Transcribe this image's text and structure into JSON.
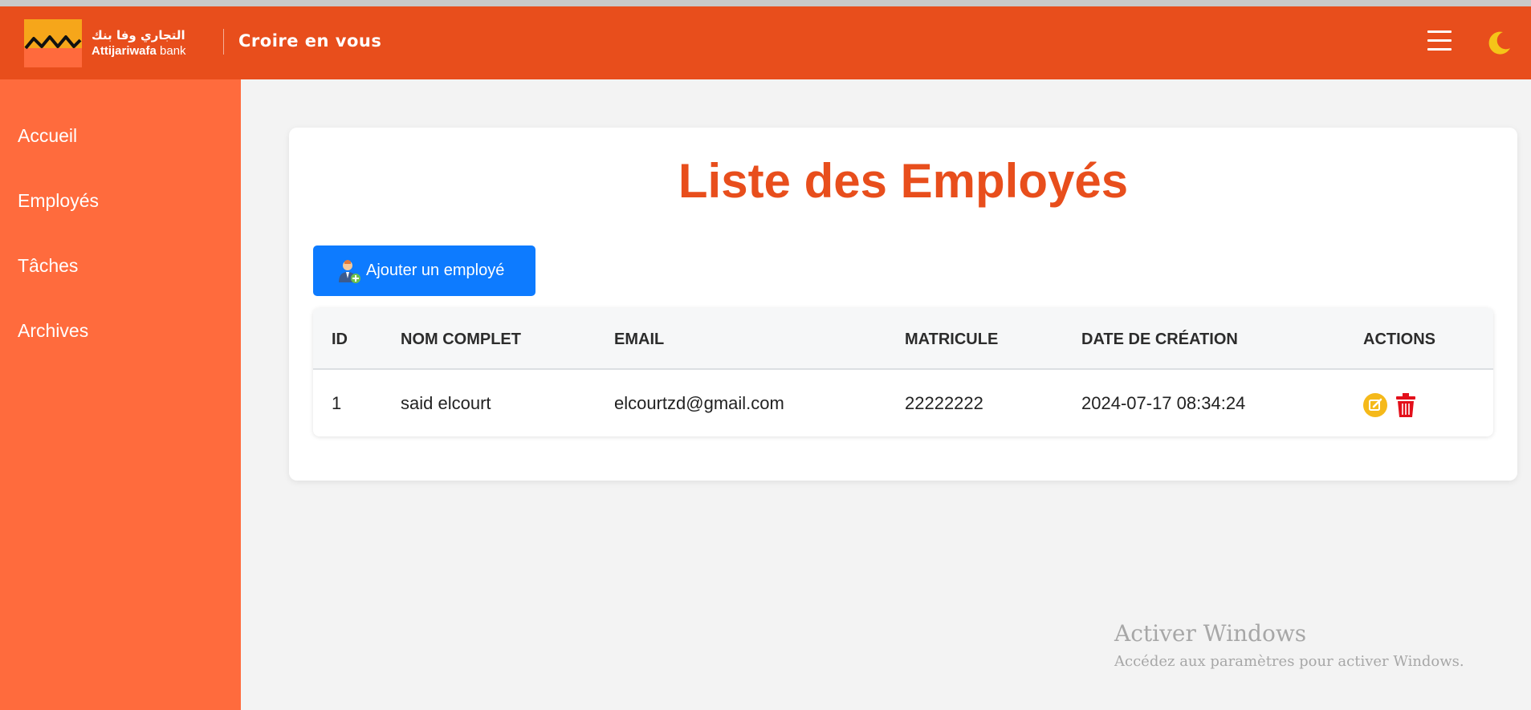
{
  "header": {
    "logo_arabic": "التجاري وفا بنك",
    "logo_latin_bold": "Attijariwafa",
    "logo_latin_light": "bank",
    "tagline": "Croire en vous",
    "menu_icon": "hamburger-icon",
    "theme_icon": "moon-icon",
    "colors": {
      "header_bg": "#e84e1c",
      "logo_yellow": "#f6a61a"
    }
  },
  "sidebar": {
    "bg_color": "#ff6b3d",
    "items": [
      {
        "label": "Accueil"
      },
      {
        "label": "Employés"
      },
      {
        "label": "Tâches"
      },
      {
        "label": "Archives"
      }
    ]
  },
  "main": {
    "title": "Liste des Employés",
    "add_button_label": "Ajouter un employé",
    "add_button_icon": "employee-add-icon",
    "table": {
      "columns": [
        "ID",
        "NOM COMPLET",
        "EMAIL",
        "MATRICULE",
        "DATE DE CRÉATION",
        "ACTIONS"
      ],
      "rows": [
        {
          "id": "1",
          "name": "said elcourt",
          "email": "elcourtzd@gmail.com",
          "matricule": "22222222",
          "created": "2024-07-17 08:34:24"
        }
      ],
      "action_icons": [
        "edit-icon",
        "trash-icon"
      ]
    }
  },
  "watermark": {
    "title": "Activer Windows",
    "subtitle": "Accédez aux paramètres pour activer Windows."
  }
}
